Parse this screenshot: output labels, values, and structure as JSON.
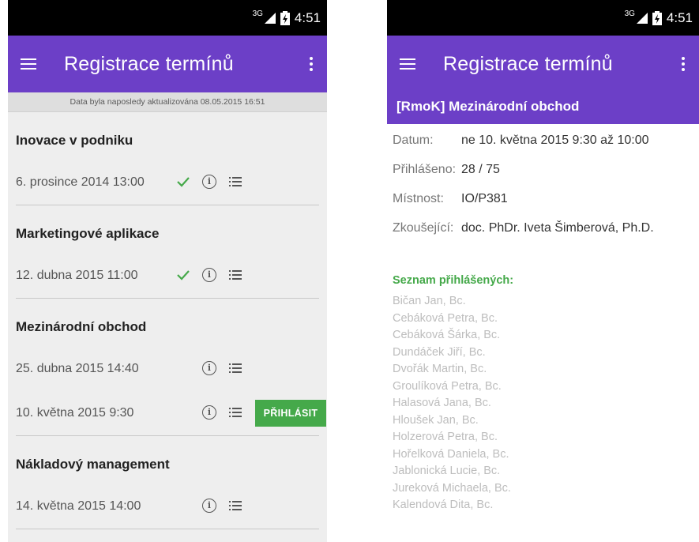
{
  "status": {
    "network": "3G",
    "time": "4:51"
  },
  "left": {
    "app_title": "Registrace termínů",
    "update_text": "Data byla naposledy aktualizována 08.05.2015 16:51",
    "subjects": [
      {
        "title": "Inovace v podniku",
        "terms": [
          {
            "date": "6. prosince 2014 13:00",
            "registered": true
          }
        ]
      },
      {
        "title": "Marketingové aplikace",
        "terms": [
          {
            "date": "12. dubna 2015 11:00",
            "registered": true
          }
        ]
      },
      {
        "title": "Mezinárodní obchod",
        "terms": [
          {
            "date": "25. dubna 2015 14:40",
            "registered": false
          },
          {
            "date": "10. května 2015 9:30",
            "registered": false,
            "button": "PŘIHLÁSIT"
          }
        ]
      },
      {
        "title": "Nákladový management",
        "terms": [
          {
            "date": "14. května 2015 14:00",
            "registered": false
          }
        ]
      }
    ]
  },
  "right": {
    "app_title": "Registrace termínů",
    "exam_title": "[RmoK] Mezinárodní obchod",
    "details": [
      {
        "label": "Datum:",
        "value": "ne 10. května 2015 9:30 až 10:00"
      },
      {
        "label": "Přihlášeno:",
        "value": "28 / 75"
      },
      {
        "label": "Místnost:",
        "value": "IO/P381"
      },
      {
        "label": "Zkoušející:",
        "value": "doc. PhDr. Iveta Šimberová, Ph.D."
      }
    ],
    "list_heading": "Seznam přihlášených:",
    "students": [
      "Bičan Jan, Bc.",
      "Cebáková Petra, Bc.",
      "Cebáková Šárka, Bc.",
      "Dundáček Jiří, Bc.",
      "Dvořák Martin, Bc.",
      "Groulíková Petra, Bc.",
      "Halasová Jana, Bc.",
      "Hloušek Jan, Bc.",
      "Holzerová Petra, Bc.",
      "Hořelková Daniela, Bc.",
      "Jablonická Lucie, Bc.",
      "Jureková Michaela, Bc.",
      "Kalendová Dita, Bc."
    ]
  },
  "colors": {
    "primary": "#6c3fc7",
    "accent_green": "#45a94a",
    "background": "#eeeeee"
  },
  "icons": [
    "menu-icon",
    "overflow-icon",
    "check-icon",
    "info-icon",
    "list-icon",
    "signal-icon",
    "battery-icon"
  ]
}
